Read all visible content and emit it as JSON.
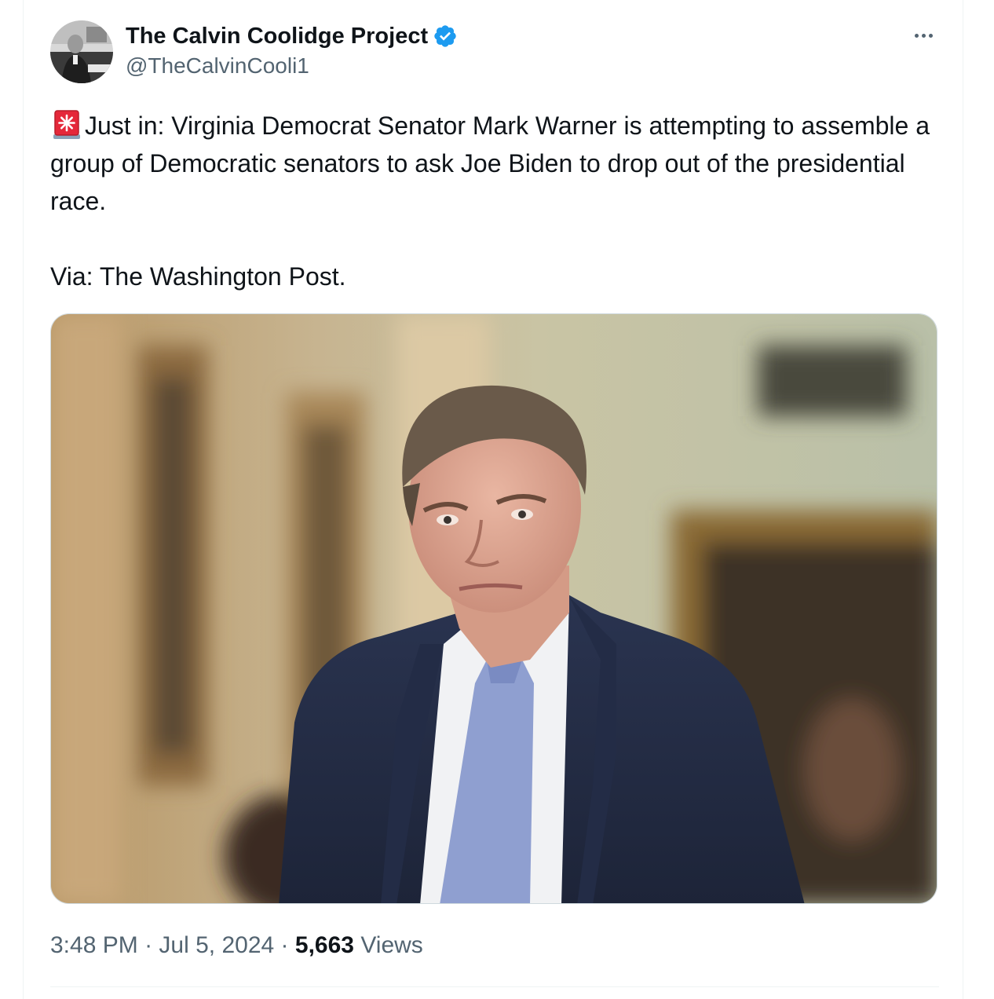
{
  "author": {
    "display_name": "The Calvin Coolidge Project",
    "handle": "@TheCalvinCooli1",
    "verified": true,
    "avatar_icon": "avatar-photo",
    "verified_color": "#1d9bf0"
  },
  "tweet": {
    "emoji_icon": "police-car-light-icon",
    "line1": "Just in: Virginia Democrat Senator Mark Warner is attempting to assemble a group of Democratic senators to ask Joe Biden to drop out of the presidential race.",
    "line2": "Via: The Washington Post.",
    "image_alt": "Photo of a man in a dark suit and light blue tie in a hallway"
  },
  "meta": {
    "time": "3:48 PM",
    "separator": "·",
    "date": "Jul 5, 2024",
    "views_count": "5,663",
    "views_label": "Views"
  },
  "menu": {
    "more_icon": "more-horizontal-icon"
  }
}
